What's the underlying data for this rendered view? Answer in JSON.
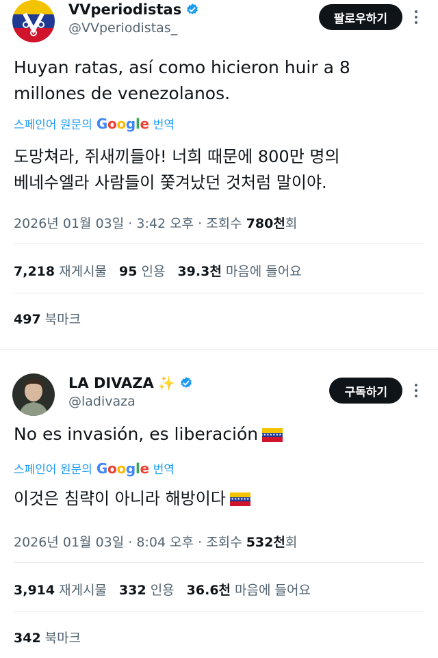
{
  "tweets": [
    {
      "display_name": "VVperiodistas",
      "handle": "@VVperiodistas_",
      "follow_label": "팔로우하기",
      "text_lines": [
        "Huyan ratas, así como hicieron huir a 8",
        "millones de venezolanos."
      ],
      "translate": {
        "prefix": "스페인어 원문의",
        "google": [
          "G",
          "o",
          "o",
          "g",
          "l",
          "e"
        ],
        "suffix": "번역"
      },
      "translated_lines": [
        "도망쳐라, 쥐새끼들아! 너희 때문에 800만 명의",
        "베네수엘라 사람들이 쫓겨났던 것처럼 말이야."
      ],
      "meta": {
        "date": "2026년 01월 03일",
        "time": "3:42 오후",
        "views_label": "조회수",
        "views_num": "780천",
        "views_suffix": "회"
      },
      "stats": {
        "reposts_num": "7,218",
        "reposts_label": "재게시물",
        "quotes_num": "95",
        "quotes_label": "인용",
        "likes_num": "39.3천",
        "likes_label": "마음에 들어요"
      },
      "bookmarks": {
        "num": "497",
        "label": "북마크"
      }
    },
    {
      "display_name": "LA DIVAZA",
      "sparkle": "✨",
      "handle": "@ladivaza",
      "follow_label": "구독하기",
      "text_lines": [
        "No es invasión, es liberación"
      ],
      "translate": {
        "prefix": "스페인어 원문의",
        "google": [
          "G",
          "o",
          "o",
          "g",
          "l",
          "e"
        ],
        "suffix": "번역"
      },
      "translated_lines": [
        "이것은 침략이 아니라 해방이다"
      ],
      "meta": {
        "date": "2026년 01월 03일",
        "time": "8:04 오후",
        "views_label": "조회수",
        "views_num": "532천",
        "views_suffix": "회"
      },
      "stats": {
        "reposts_num": "3,914",
        "reposts_label": "재게시물",
        "quotes_num": "332",
        "quotes_label": "인용",
        "likes_num": "36.6천",
        "likes_label": "마음에 들어요"
      },
      "bookmarks": {
        "num": "342",
        "label": "북마크"
      }
    }
  ],
  "colors": {
    "link": "#1d9bf0",
    "secondary": "#536471",
    "verified": "#1d9bf0",
    "button": "#0f1419"
  }
}
